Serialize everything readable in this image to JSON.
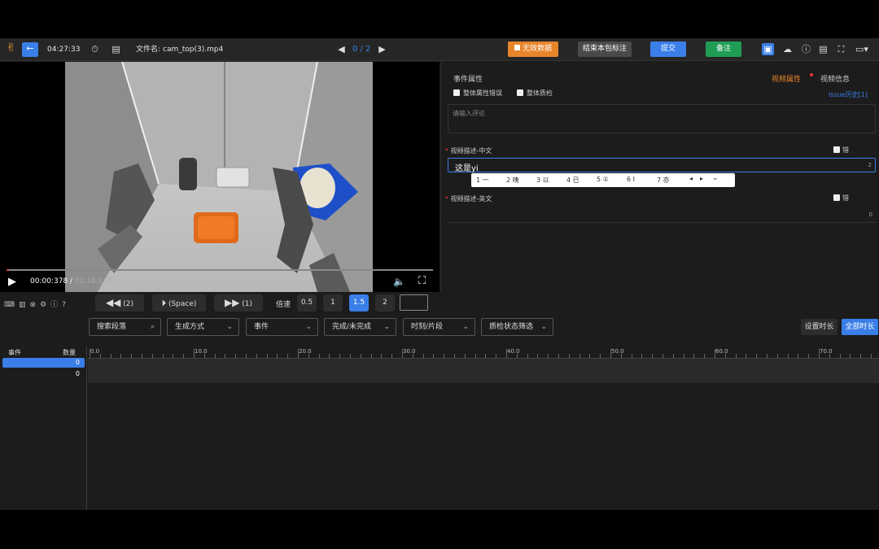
{
  "topbar": {
    "timer": "04:27:33",
    "file_label": "文件名:",
    "file_name": "cam_top(3).mp4",
    "page_counter": "0 / 2",
    "invalid_btn": "无效数据",
    "end_pkg_btn": "结束本包标注",
    "submit_btn": "提交",
    "remark_btn": "备注"
  },
  "player": {
    "current_time": "00:00:378",
    "total_time": "01:16:167",
    "progress": 0.005
  },
  "playback": {
    "rewind_label": "(2)",
    "play_label": "(Space)",
    "forward_label": "(1)",
    "speed_label": "倍速",
    "speeds": [
      "0.5",
      "1",
      "1.5",
      "2"
    ],
    "active_speed": "1.5"
  },
  "panel": {
    "event_attr": "事件属性",
    "tab_video_attr": "视频属性",
    "tab_video_info": "视频信息",
    "check_overall_error": "整体属性错误",
    "check_overall_qc": "整体质检",
    "issue_history": "Issue历史[1]",
    "comment_placeholder": "请输入评论",
    "desc_cn_label": "视频描述-中文",
    "desc_cn_value": "这是yi",
    "desc_cn_count": "2",
    "desc_en_label": "视频描述-英文",
    "desc_en_count": "0",
    "wrong_label": "错",
    "ime_candidates": [
      "1 一",
      "2 咦",
      "3 以",
      "4 已",
      "5 ①",
      "6 Ⅰ",
      "7 亦"
    ]
  },
  "filters": {
    "search_placeholder": "搜索段落",
    "gen_mode": "生成方式",
    "event": "事件",
    "complete": "完成/未完成",
    "time_seg": "时刻/片段",
    "qc_filter": "质检状态筛选",
    "set_duration": "设置时长",
    "all_duration": "全部时长"
  },
  "timeline": {
    "col_event": "事件",
    "col_count": "数量",
    "rows": [
      {
        "name": "",
        "count": "0"
      },
      {
        "name": "",
        "count": "0"
      }
    ],
    "ruler": [
      "0.0",
      "10.0",
      "20.0",
      "30.0",
      "40.0",
      "50.0",
      "60.0",
      "70.0"
    ]
  },
  "colors": {
    "accent_blue": "#3a7ee8",
    "orange": "#e8852b",
    "green": "#1f9d55",
    "gray_btn": "#4a4a4a"
  }
}
